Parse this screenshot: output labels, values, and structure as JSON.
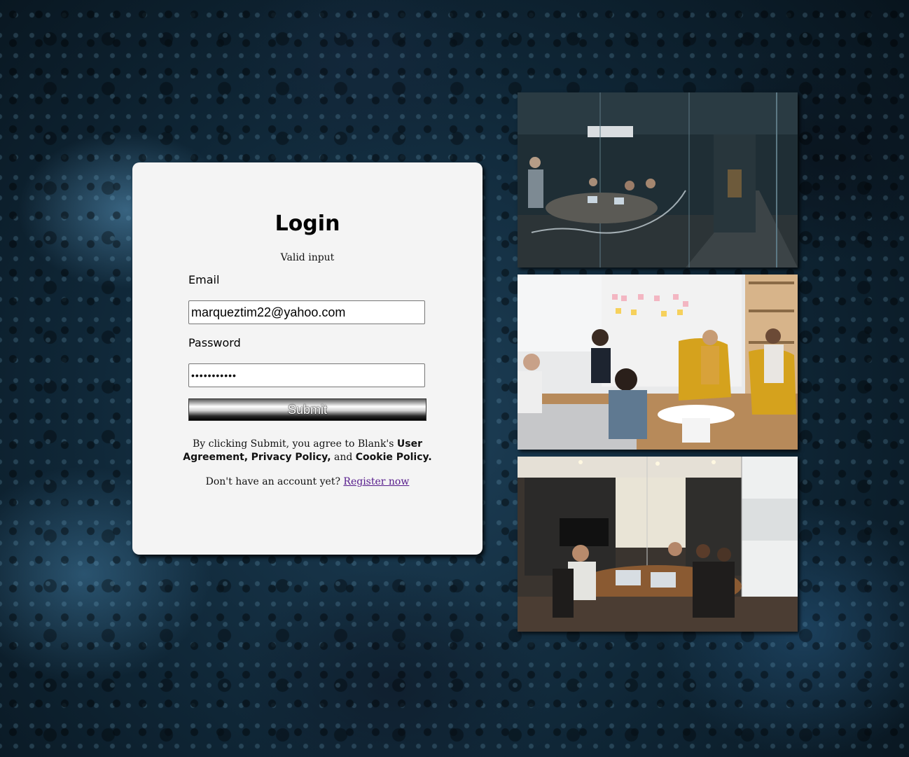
{
  "login": {
    "title": "Login",
    "status": "Valid input",
    "email_label": "Email",
    "email_value": "marqueztim22@yahoo.com",
    "password_label": "Password",
    "password_value": "•••••••••••",
    "submit_label": "Submit",
    "terms": {
      "prefix": "By clicking Submit, you agree to Blank's",
      "user_agreement": "User Agreement,",
      "privacy_policy": "Privacy Policy,",
      "and": "and",
      "cookie_policy": "Cookie Policy."
    },
    "register_prompt": "Don't have an account yet?",
    "register_link": "Register now"
  },
  "photos": [
    {
      "name": "office-meeting-glass-room-photo"
    },
    {
      "name": "team-lounge-discussion-photo"
    },
    {
      "name": "conference-room-laptops-photo"
    }
  ],
  "colors": {
    "card_bg": "#f4f4f4",
    "link": "#551a8b",
    "background": "#0f2636"
  }
}
